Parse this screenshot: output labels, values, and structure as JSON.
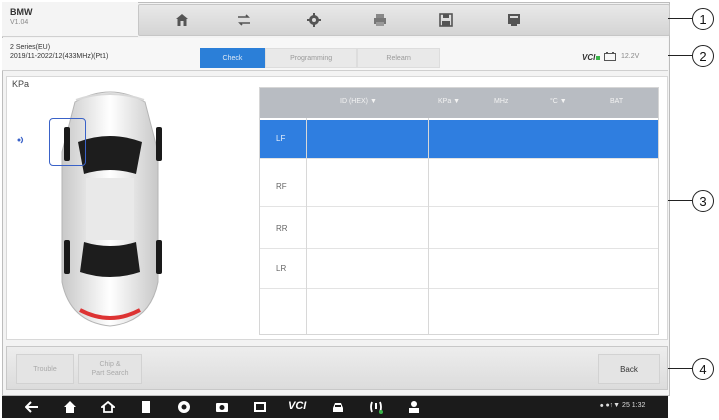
{
  "toolbar": {
    "brand": "BMW",
    "version": "V1.04",
    "icons": [
      "home-icon",
      "vehicle-swap-icon",
      "settings-gear-icon",
      "print-icon",
      "save-icon",
      "data-logging-icon"
    ]
  },
  "vehicle": {
    "line1": "2 Series(EU)",
    "line2": "2019/11-2022/12(433MHz)(Pt1)"
  },
  "tabs": [
    {
      "label": "Check",
      "active": true
    },
    {
      "label": "Programming",
      "active": false
    },
    {
      "label": "Relearn",
      "active": false
    }
  ],
  "status": {
    "vci": "VCI",
    "voltage": "12.2V"
  },
  "main": {
    "unit": "KPa",
    "columns": [
      "",
      "ID (HEX) ▼",
      "KPa ▼",
      "MHz",
      "°C ▼",
      "BAT"
    ],
    "rows": [
      {
        "position": "LF",
        "selected": true
      },
      {
        "position": "RF",
        "selected": false
      },
      {
        "position": "RR",
        "selected": false
      },
      {
        "position": "LR",
        "selected": false
      },
      {
        "position": "",
        "selected": false
      }
    ]
  },
  "bottom": {
    "trouble_label": "Trouble",
    "chip_label_1": "Chip &",
    "chip_label_2": "Part Search",
    "back_label": "Back"
  },
  "callouts": [
    "1",
    "2",
    "3",
    "4"
  ],
  "navbar": {
    "vci_label": "VCI",
    "status_text": "⦁ ●↑▼ 25 1:32"
  },
  "colors": {
    "accent": "#2f7ee0",
    "header": "#b8bcc2",
    "nav": "#1b1b1b"
  }
}
